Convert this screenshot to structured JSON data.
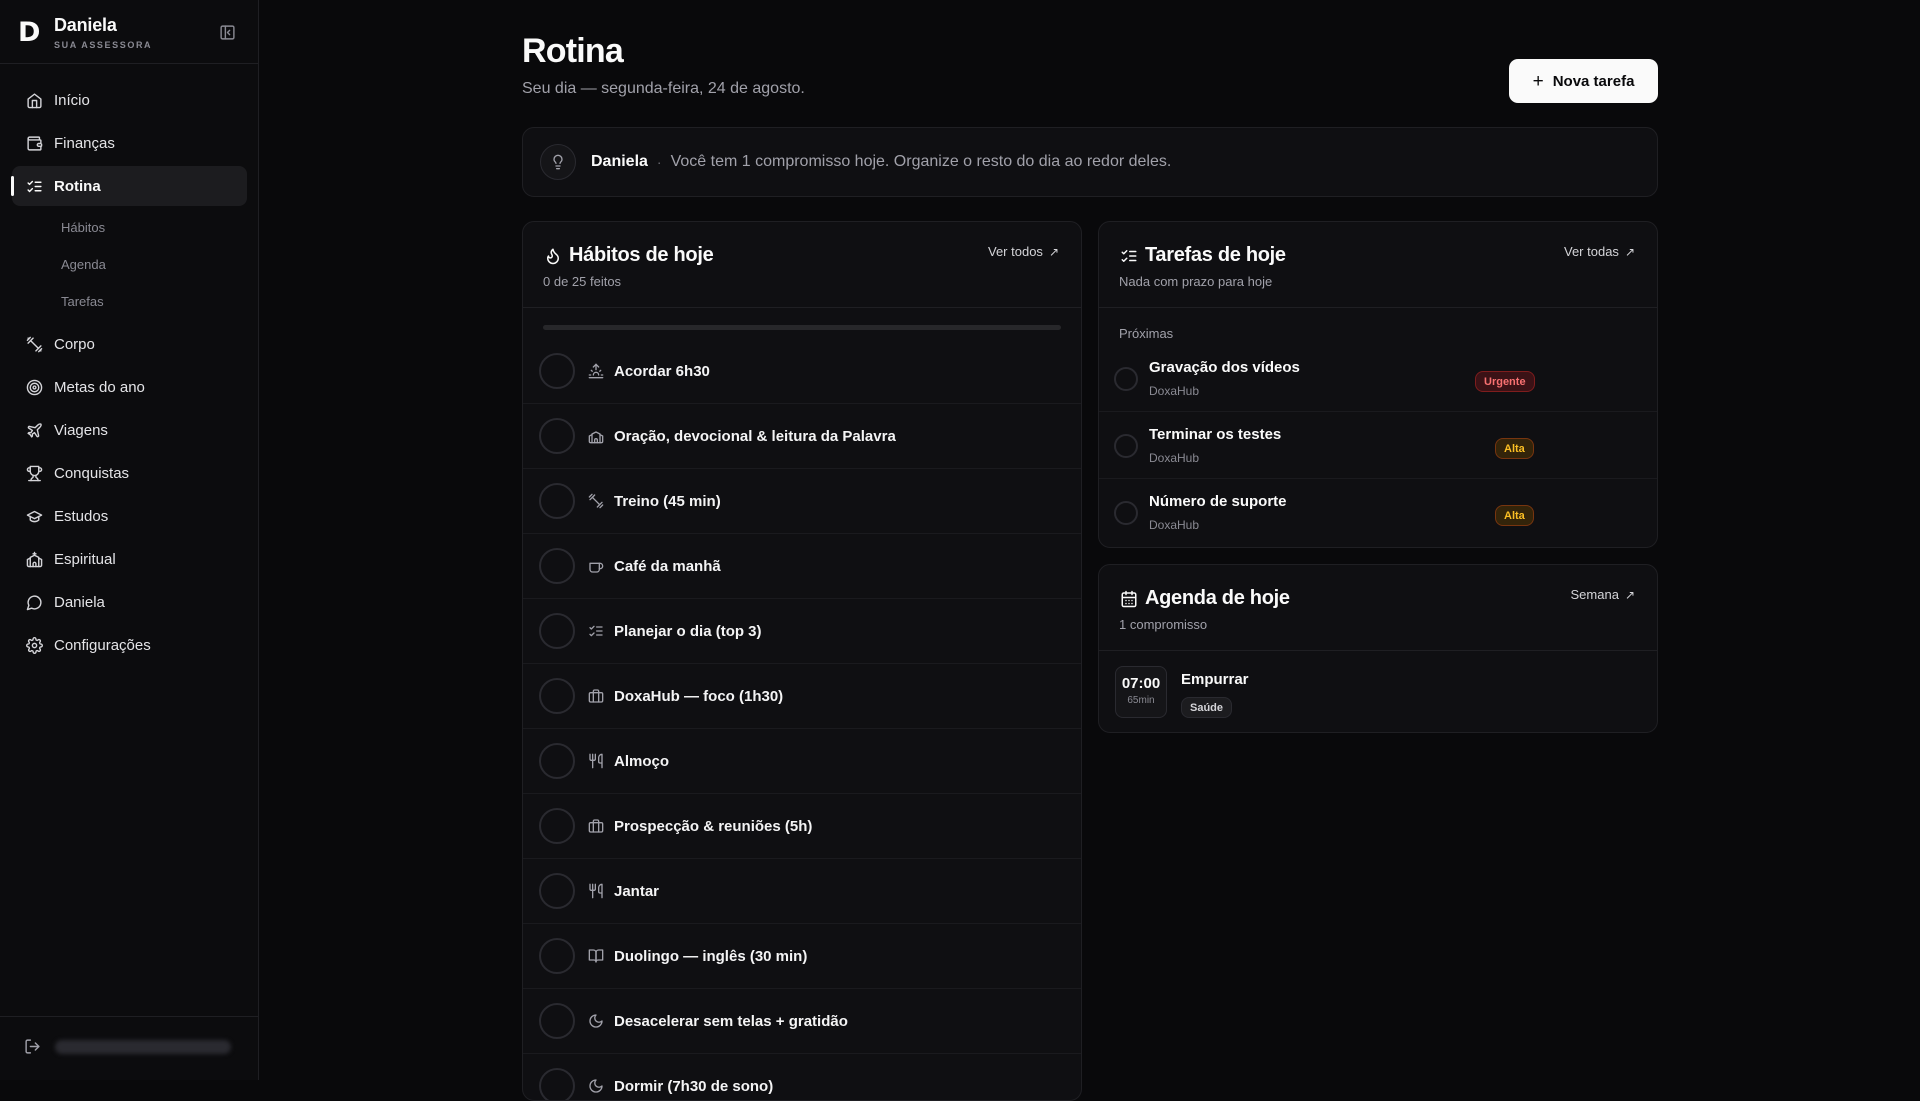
{
  "sidebar": {
    "brand_letter": "D",
    "brand_name": "Daniela",
    "brand_sub": "SUA ASSESSORA",
    "items": [
      {
        "label": "Início",
        "icon": "home-icon"
      },
      {
        "label": "Finanças",
        "icon": "wallet-icon"
      },
      {
        "label": "Rotina",
        "icon": "list-checks-icon",
        "active": true
      },
      {
        "label": "Corpo",
        "icon": "dumbbell-icon"
      },
      {
        "label": "Metas do ano",
        "icon": "target-icon"
      },
      {
        "label": "Viagens",
        "icon": "plane-icon"
      },
      {
        "label": "Conquistas",
        "icon": "trophy-icon"
      },
      {
        "label": "Estudos",
        "icon": "graduation-cap-icon"
      },
      {
        "label": "Espiritual",
        "icon": "church-icon"
      },
      {
        "label": "Daniela",
        "icon": "message-circle-icon"
      },
      {
        "label": "Configurações",
        "icon": "gear-icon"
      }
    ],
    "subitems": [
      "Hábitos",
      "Agenda",
      "Tarefas"
    ]
  },
  "header": {
    "title": "Rotina",
    "subtitle": "Seu dia — segunda-feira, 24 de agosto.",
    "new_task_label": "Nova tarefa"
  },
  "tip": {
    "name": "Daniela",
    "separator": "·",
    "text": "Você tem 1 compromisso hoje. Organize o resto do dia ao redor deles."
  },
  "habits": {
    "title": "Hábitos de hoje",
    "subtitle": "0 de 25 feitos",
    "link": "Ver todos",
    "progress": 0,
    "items": [
      {
        "label": "Acordar 6h30",
        "icon": "sunrise-icon"
      },
      {
        "label": "Oração, devocional & leitura da Palavra",
        "icon": "church-icon"
      },
      {
        "label": "Treino (45 min)",
        "icon": "dumbbell-icon"
      },
      {
        "label": "Café da manhã",
        "icon": "coffee-icon"
      },
      {
        "label": "Planejar o dia (top 3)",
        "icon": "list-checks-icon"
      },
      {
        "label": "DoxaHub — foco (1h30)",
        "icon": "briefcase-icon"
      },
      {
        "label": "Almoço",
        "icon": "utensils-icon"
      },
      {
        "label": "Prospecção & reuniões (5h)",
        "icon": "briefcase-icon"
      },
      {
        "label": "Jantar",
        "icon": "utensils-icon"
      },
      {
        "label": "Duolingo — inglês (30 min)",
        "icon": "book-icon"
      },
      {
        "label": "Desacelerar sem telas + gratidão",
        "icon": "moon-icon"
      },
      {
        "label": "Dormir (7h30 de sono)",
        "icon": "moon-icon"
      }
    ]
  },
  "tasks": {
    "title": "Tarefas de hoje",
    "subtitle": "Nada com prazo para hoje",
    "link": "Ver todas",
    "section": "Próximas",
    "items": [
      {
        "name": "Gravação dos vídeos",
        "project": "DoxaHub",
        "priority": "Urgente"
      },
      {
        "name": "Terminar os testes",
        "project": "DoxaHub",
        "priority": "Alta"
      },
      {
        "name": "Número de suporte",
        "project": "DoxaHub",
        "priority": "Alta"
      }
    ]
  },
  "agenda": {
    "title": "Agenda de hoje",
    "subtitle": "1 compromisso",
    "link": "Semana",
    "events": [
      {
        "time": "07:00",
        "duration": "65min",
        "title": "Empurrar",
        "tag": "Saúde"
      }
    ]
  },
  "colors": {
    "background": "#09090b",
    "surface": "#0f0f12",
    "urgent": "#f87171",
    "high": "#fbbf24"
  }
}
